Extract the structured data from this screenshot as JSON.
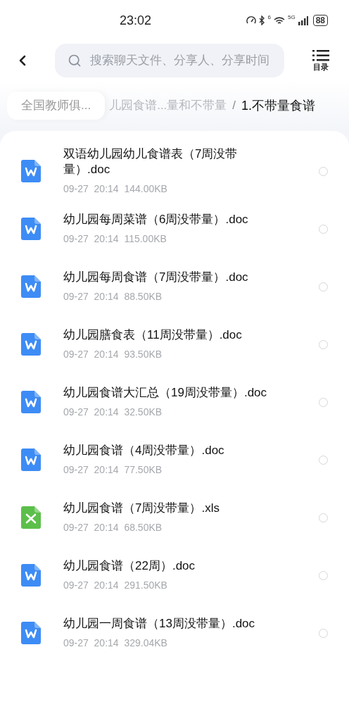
{
  "status_bar": {
    "time": "23:02",
    "wifi_badge": "6",
    "network": "5G",
    "battery": "88"
  },
  "header": {
    "search": {
      "placeholder": "搜索聊天文件、分享人、分享时间"
    },
    "catalog_label": "目录"
  },
  "breadcrumb": [
    {
      "label": "全国教师俱...",
      "kind": "chip"
    },
    {
      "label": "儿园食谱...量和不带量",
      "kind": "faded"
    },
    {
      "label": "/",
      "kind": "separator"
    },
    {
      "label": "1.不带量食谱",
      "kind": "current"
    }
  ],
  "files": [
    {
      "name": "双语幼儿园幼儿食谱表（7周没带量）.doc",
      "date": "09-27",
      "time": "20:14",
      "size": "144.00KB",
      "kind": "doc",
      "selected": false
    },
    {
      "name": "幼儿园每周菜谱（6周没带量）.doc",
      "date": "09-27",
      "time": "20:14",
      "size": "115.00KB",
      "kind": "doc",
      "selected": false
    },
    {
      "name": "幼儿园每周食谱（7周没带量）.doc",
      "date": "09-27",
      "time": "20:14",
      "size": "88.50KB",
      "kind": "doc",
      "selected": false
    },
    {
      "name": "幼儿园膳食表（11周没带量）.doc",
      "date": "09-27",
      "time": "20:14",
      "size": "93.50KB",
      "kind": "doc",
      "selected": false
    },
    {
      "name": "幼儿园食谱大汇总（19周没带量）.doc",
      "date": "09-27",
      "time": "20:14",
      "size": "32.50KB",
      "kind": "doc",
      "selected": false
    },
    {
      "name": "幼儿园食谱（4周没带量）.doc",
      "date": "09-27",
      "time": "20:14",
      "size": "77.50KB",
      "kind": "doc",
      "selected": false
    },
    {
      "name": "幼儿园食谱（7周没带量）.xls",
      "date": "09-27",
      "time": "20:14",
      "size": "68.50KB",
      "kind": "xls",
      "selected": false
    },
    {
      "name": "幼儿园食谱（22周）.doc",
      "date": "09-27",
      "time": "20:14",
      "size": "291.50KB",
      "kind": "doc",
      "selected": false
    },
    {
      "name": "幼儿园一周食谱（13周没带量）.doc",
      "date": "09-27",
      "time": "20:14",
      "size": "329.04KB",
      "kind": "doc",
      "selected": false
    }
  ]
}
